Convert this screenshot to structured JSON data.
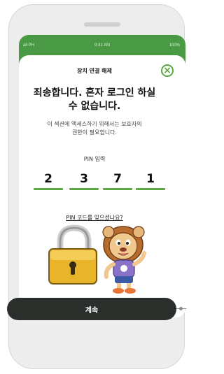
{
  "status_bar": {
    "carrier": "all PH",
    "time": "9:41 AM",
    "battery": "100%"
  },
  "dialog": {
    "title": "장치 연결 해제",
    "close_icon": "close-icon",
    "headline_line1": "죄송합니다. 혼자 로그인 하실",
    "headline_line2": "수 없습니다.",
    "description_line1": "이 섹션에 액세스하기 위해서는 보호자의",
    "description_line2": "권한이 필요합니다.",
    "pin_label": "PIN 입력",
    "pin_digits": [
      "2",
      "3",
      "7",
      "1"
    ],
    "forgot_link": "PIN 코드를 잊으셨나요?",
    "continue_label": "계속"
  },
  "colors": {
    "accent": "#5aa83f",
    "header_green": "#4a9a45",
    "button_dark": "#2b2f2c"
  },
  "icons": [
    "lock-icon",
    "lion-mascot-icon",
    "close-icon"
  ]
}
